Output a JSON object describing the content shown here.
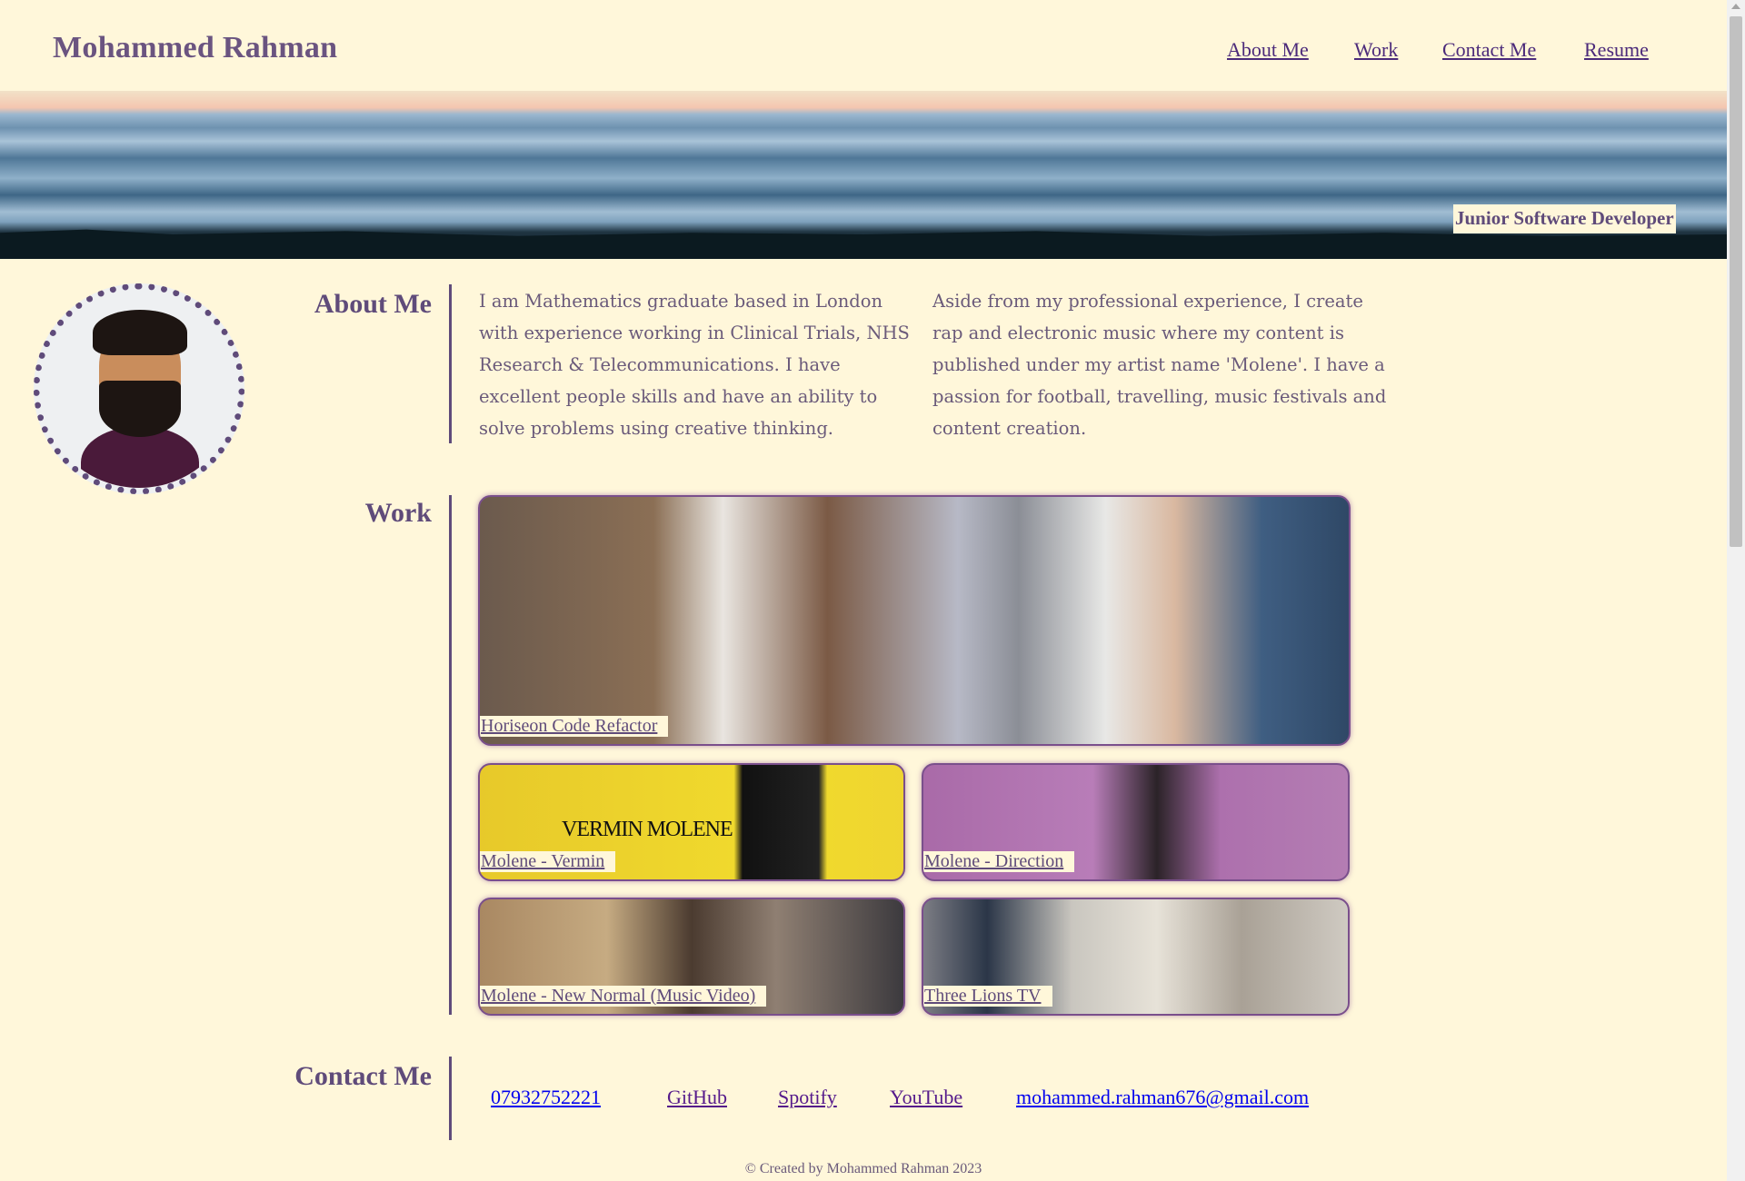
{
  "header": {
    "name": "Mohammed Rahman",
    "nav": [
      "About Me",
      "Work",
      "Contact Me",
      "Resume"
    ]
  },
  "hero": {
    "badge": "Junior Software Developer"
  },
  "about": {
    "title": "About Me",
    "paragraphs": [
      "I am Mathematics graduate based in London with experience working in Clinical Trials, NHS Research & Telecommunications. I have excellent people skills and have an ability to solve problems using creative thinking.",
      "Aside from my professional experience, I create rap and electronic music where my content is published under my artist name 'Molene'. I have a passion for football, travelling, music festivals and content creation."
    ]
  },
  "work": {
    "title": "Work",
    "projects": [
      "Horiseon Code Refactor",
      "Molene - Vermin",
      "Molene - Direction",
      "Molene - New Normal (Music Video)",
      "Three Lions TV"
    ],
    "vinyl_art": "VERMIN  MOLENE"
  },
  "contact": {
    "title": "Contact Me",
    "links": [
      "07932752221",
      "GitHub",
      "Spotify",
      "YouTube",
      "mohammed.rahman676@gmail.com"
    ],
    "colors": {
      "unvisited": "#0000ee",
      "visited": "#551a8b"
    }
  },
  "footer": "© Created by Mohammed Rahman 2023"
}
